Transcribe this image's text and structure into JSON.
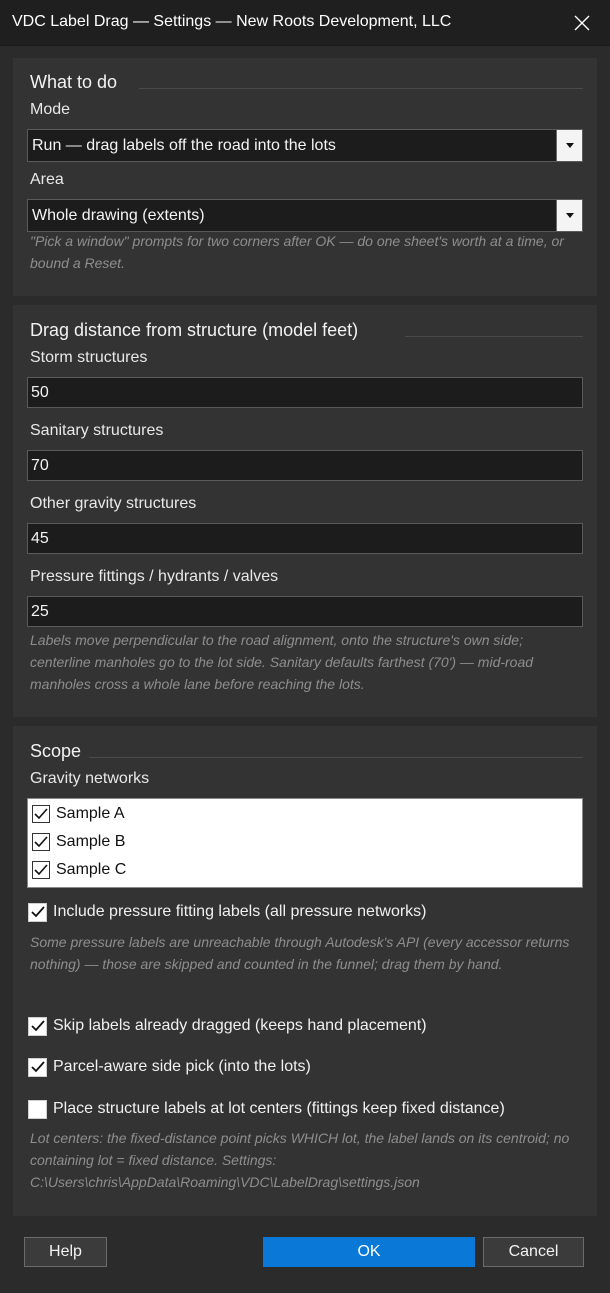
{
  "window": {
    "title": "VDC Label Drag — Settings — New Roots Development, LLC",
    "close_icon": "close-icon"
  },
  "what_to_do": {
    "title": "What to do",
    "mode_label": "Mode",
    "mode_value": "Run — drag labels off the road into the lots",
    "area_label": "Area",
    "area_value": "Whole drawing (extents)",
    "hint": "\"Pick a window\" prompts for two corners after OK — do one sheet's worth at a time, or bound a Reset."
  },
  "drag_distance": {
    "title": "Drag distance from structure (model feet)",
    "storm_label": "Storm structures",
    "storm_value": "50",
    "sanitary_label": "Sanitary structures",
    "sanitary_value": "70",
    "other_label": "Other gravity structures",
    "other_value": "45",
    "pressure_label": "Pressure fittings / hydrants / valves",
    "pressure_value": "25",
    "hint": "Labels move perpendicular to the road alignment, onto the structure's own side; centerline manholes go to the lot side. Sanitary defaults farthest (70') — mid-road manholes cross a whole lane before reaching the lots."
  },
  "scope": {
    "title": "Scope",
    "networks_label": "Gravity networks",
    "networks": [
      {
        "label": "Sample A",
        "checked": true
      },
      {
        "label": "Sample B",
        "checked": true
      },
      {
        "label": "Sample C",
        "checked": true
      }
    ],
    "include_pressure": {
      "label": "Include pressure fitting labels (all pressure networks)",
      "checked": true
    },
    "pressure_hint": "Some pressure labels are unreachable through Autodesk's API (every accessor returns  nothing) — those are skipped and counted in the funnel; drag them by hand.",
    "skip_dragged": {
      "label": "Skip labels already dragged (keeps hand placement)",
      "checked": true
    },
    "parcel_aware": {
      "label": "Parcel-aware side pick (into the lots)",
      "checked": true
    },
    "lot_centers": {
      "label": "Place structure labels at lot centers (fittings keep fixed distance)",
      "checked": false
    },
    "lot_hint": "Lot centers: the fixed-distance point picks WHICH lot, the label lands on its centroid; no containing lot = fixed distance. Settings: C:\\Users\\chris\\AppData\\Roaming\\VDC\\LabelDrag\\settings.json"
  },
  "buttons": {
    "help": "Help",
    "ok": "OK",
    "cancel": "Cancel"
  },
  "colors": {
    "accent": "#0a78d7",
    "background": "#2b2b2b",
    "panel": "#333333",
    "input": "#1c1c1c"
  }
}
